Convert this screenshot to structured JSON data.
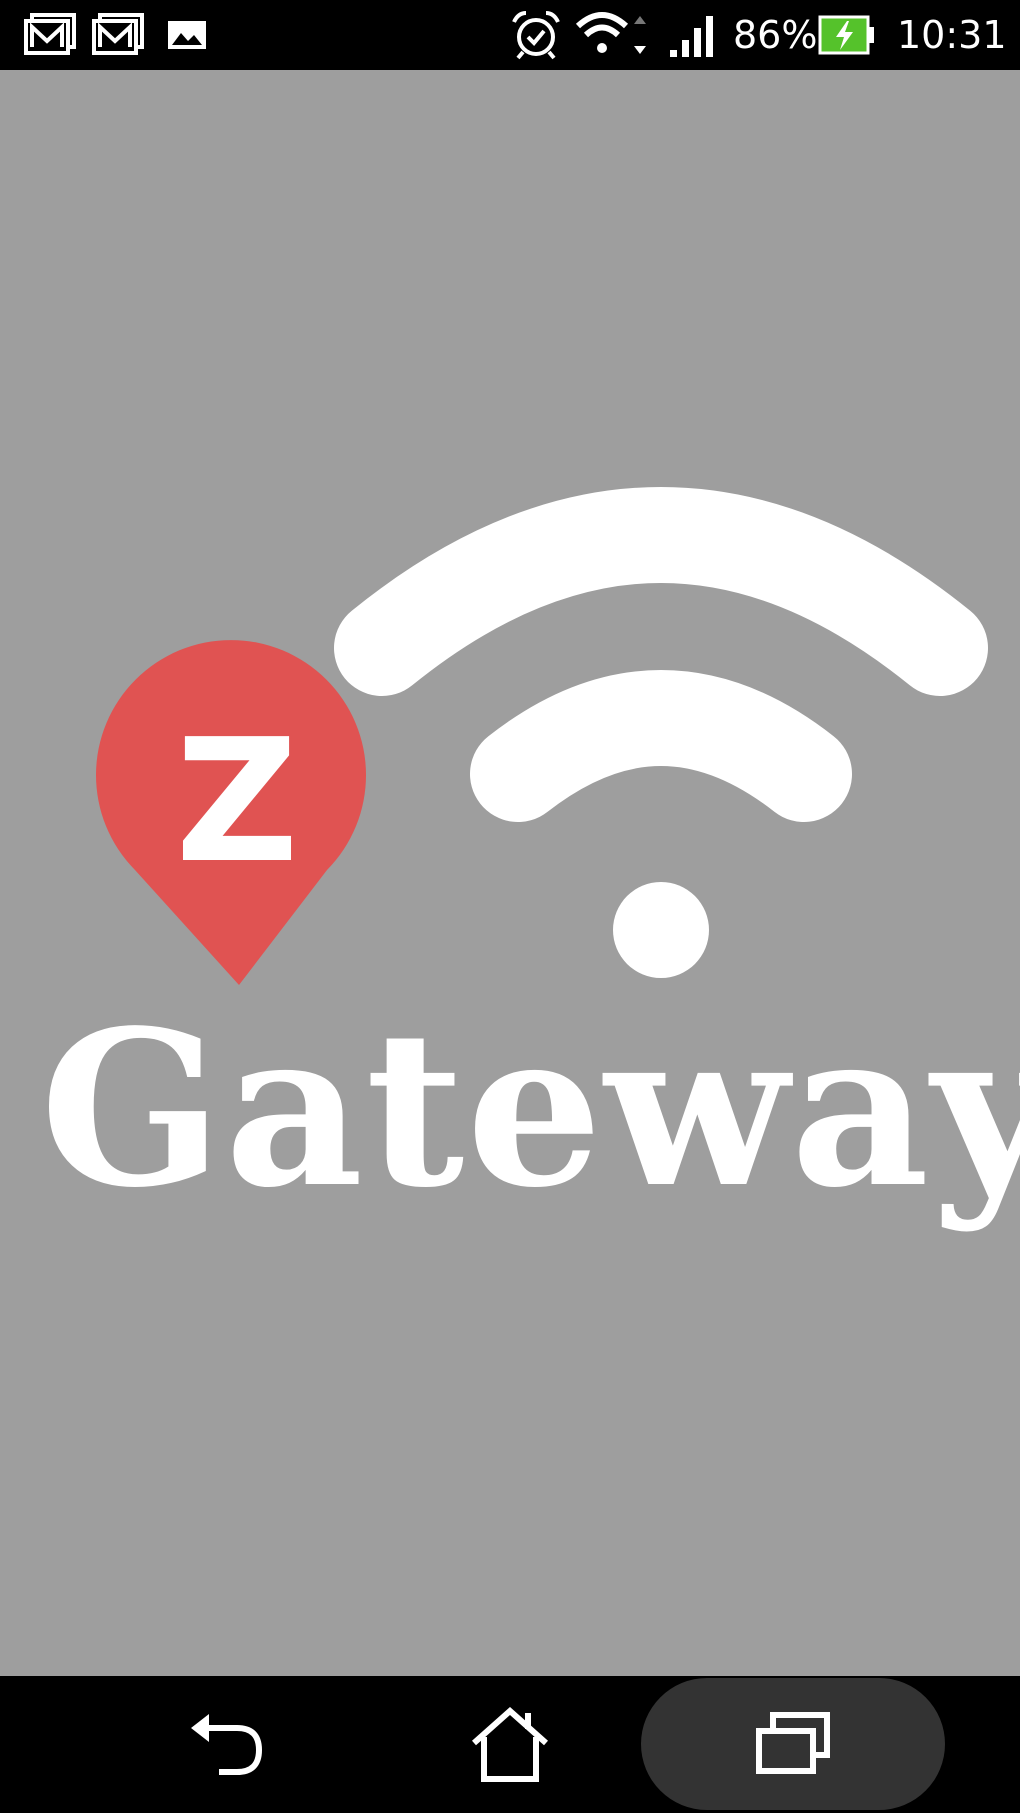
{
  "status_bar": {
    "notification_icons": [
      "gmail-icon",
      "gmail-icon",
      "image-icon"
    ],
    "system_icons": [
      "alarm-icon",
      "wifi-icon",
      "signal-icon",
      "battery-charging-icon"
    ],
    "battery_percent": "86%",
    "time": "10:31"
  },
  "splash": {
    "background_color": "#9e9e9e",
    "pin_color": "#e05352",
    "pin_letter": "Z",
    "wifi_color": "#ffffff",
    "brand_name": "Gateway"
  },
  "navigation_bar": {
    "buttons": [
      "back-icon",
      "home-icon",
      "recent-apps-icon"
    ]
  }
}
